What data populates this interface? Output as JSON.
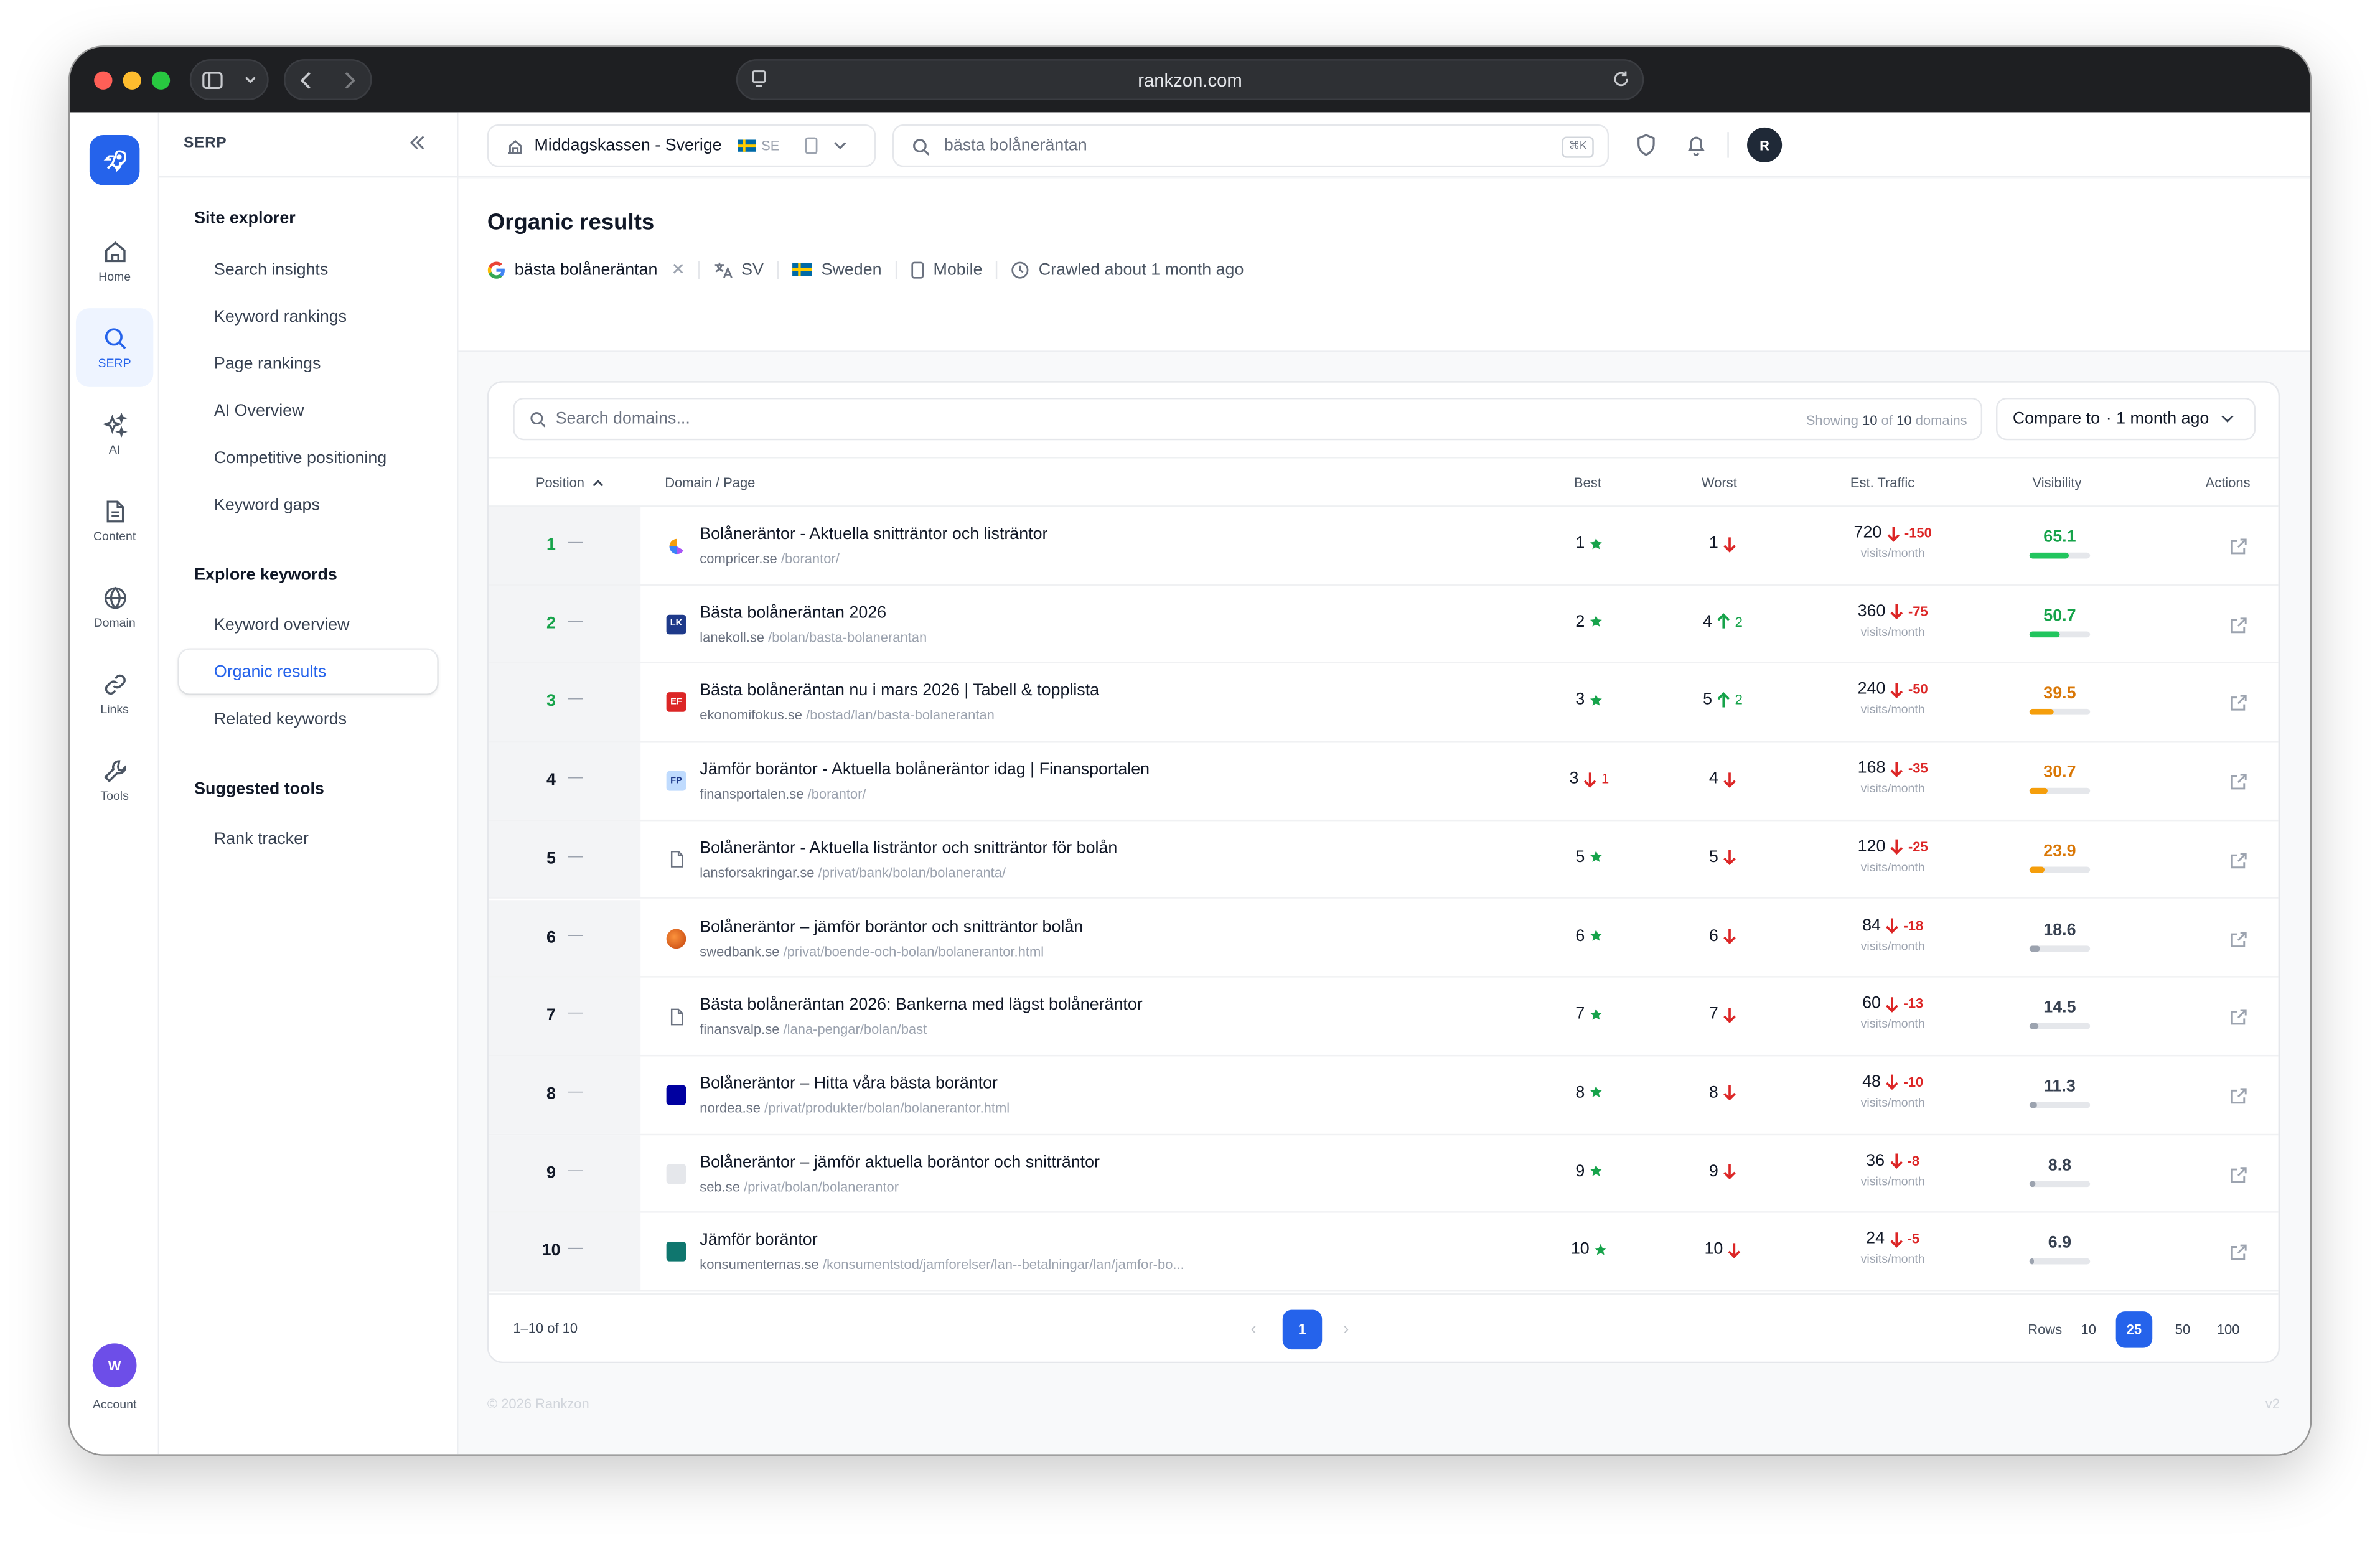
{
  "browser": {
    "url": "rankzon.com"
  },
  "rail": {
    "items": [
      {
        "label": "Home",
        "icon": "home-icon"
      },
      {
        "label": "SERP",
        "icon": "search-icon"
      },
      {
        "label": "AI",
        "icon": "sparkles-icon"
      },
      {
        "label": "Content",
        "icon": "document-icon"
      },
      {
        "label": "Domain",
        "icon": "globe-icon"
      },
      {
        "label": "Links",
        "icon": "link-icon"
      },
      {
        "label": "Tools",
        "icon": "wrench-icon"
      }
    ],
    "account_initial": "W",
    "account_label": "Account"
  },
  "sidenav": {
    "title": "SERP",
    "groups": [
      {
        "label": "Site explorer",
        "items": [
          "Search insights",
          "Keyword rankings",
          "Page rankings",
          "AI Overview",
          "Competitive positioning",
          "Keyword gaps"
        ]
      },
      {
        "label": "Explore keywords",
        "items": [
          "Keyword overview",
          "Organic results",
          "Related keywords"
        ]
      },
      {
        "label": "Suggested tools",
        "items": [
          "Rank tracker"
        ]
      }
    ],
    "active_item": "Organic results"
  },
  "topbar": {
    "project": "Middagskassen - Sverige",
    "project_country": "SE",
    "search_placeholder": "bästa bolåneräntan",
    "shortcut": "⌘K",
    "user_initial": "R"
  },
  "page": {
    "title": "Organic results",
    "keyword": "bästa bolåneräntan",
    "language": "SV",
    "country": "Sweden",
    "device": "Mobile",
    "crawled": "Crawled about 1 month ago"
  },
  "table": {
    "search_placeholder": "Search domains...",
    "showing_prefix": "Showing",
    "showing_count": "10",
    "showing_of": "of",
    "showing_total": "10",
    "showing_suffix": "domains",
    "compare_label": "Compare to",
    "compare_value": "· 1 month ago",
    "columns": {
      "position": "Position",
      "domain": "Domain / Page",
      "best": "Best",
      "worst": "Worst",
      "traffic": "Est. Traffic",
      "visibility": "Visibility",
      "actions": "Actions"
    },
    "traffic_unit": "visits/month",
    "rows": [
      {
        "pos": "1",
        "title": "Bolåneräntor - Aktuella snitträntor och listräntor",
        "domain": "compricer.se",
        "path": "/borantor/",
        "best": "1",
        "best_dir": "star",
        "best_delta": "",
        "worst": "1",
        "worst_dir": "down",
        "worst_delta": "",
        "traffic": "720",
        "traffic_change": "-150",
        "visibility": "65.1",
        "vis_pct": 65.1,
        "vis_color": "#22c55e",
        "favicon_color": "#f59e0b",
        "favicon_text": ""
      },
      {
        "pos": "2",
        "title": "Bästa bolåneräntan 2026",
        "domain": "lanekoll.se",
        "path": "/bolan/basta-bolanerantan",
        "best": "2",
        "best_dir": "star",
        "best_delta": "",
        "worst": "4",
        "worst_dir": "up",
        "worst_delta": "2",
        "traffic": "360",
        "traffic_change": "-75",
        "visibility": "50.7",
        "vis_pct": 50.7,
        "vis_color": "#22c55e",
        "favicon_color": "#1e3a8a",
        "favicon_text": "LK"
      },
      {
        "pos": "3",
        "title": "Bästa bolåneräntan nu i mars 2026 | Tabell & topplista",
        "domain": "ekonomifokus.se",
        "path": "/bostad/lan/basta-bolanerantan",
        "best": "3",
        "best_dir": "star",
        "best_delta": "",
        "worst": "5",
        "worst_dir": "up",
        "worst_delta": "2",
        "traffic": "240",
        "traffic_change": "-50",
        "visibility": "39.5",
        "vis_pct": 39.5,
        "vis_color": "#f59e0b",
        "favicon_color": "#dc2626",
        "favicon_text": "EF"
      },
      {
        "pos": "4",
        "title": "Jämför boräntor - Aktuella bolåneräntor idag | Finansportalen",
        "domain": "finansportalen.se",
        "path": "/borantor/",
        "best": "3",
        "best_dir": "down",
        "best_delta": "1",
        "worst": "4",
        "worst_dir": "down",
        "worst_delta": "",
        "traffic": "168",
        "traffic_change": "-35",
        "visibility": "30.7",
        "vis_pct": 30.7,
        "vis_color": "#f59e0b",
        "favicon_color": "#bfdbfe",
        "favicon_text": "FP"
      },
      {
        "pos": "5",
        "title": "Bolåneräntor - Aktuella listräntor och snitträntor för bolån",
        "domain": "lansforsakringar.se",
        "path": "/privat/bank/bolan/bolaneranta/",
        "best": "5",
        "best_dir": "star",
        "best_delta": "",
        "worst": "5",
        "worst_dir": "down",
        "worst_delta": "",
        "traffic": "120",
        "traffic_change": "-25",
        "visibility": "23.9",
        "vis_pct": 23.9,
        "vis_color": "#f59e0b",
        "favicon_color": "",
        "favicon_text": ""
      },
      {
        "pos": "6",
        "title": "Bolåneräntor – jämför boräntor och snitträntor bolån",
        "domain": "swedbank.se",
        "path": "/privat/boende-och-bolan/bolanerantor.html",
        "best": "6",
        "best_dir": "star",
        "best_delta": "",
        "worst": "6",
        "worst_dir": "down",
        "worst_delta": "",
        "traffic": "84",
        "traffic_change": "-18",
        "visibility": "18.6",
        "vis_pct": 18.6,
        "vis_color": "#9ca3af",
        "favicon_color": "#ea580c",
        "favicon_text": ""
      },
      {
        "pos": "7",
        "title": "Bästa bolåneräntan 2026: Bankerna med lägst bolåneräntor",
        "domain": "finansvalp.se",
        "path": "/lana-pengar/bolan/bast",
        "best": "7",
        "best_dir": "star",
        "best_delta": "",
        "worst": "7",
        "worst_dir": "down",
        "worst_delta": "",
        "traffic": "60",
        "traffic_change": "-13",
        "visibility": "14.5",
        "vis_pct": 14.5,
        "vis_color": "#9ca3af",
        "favicon_color": "",
        "favicon_text": ""
      },
      {
        "pos": "8",
        "title": "Bolåneräntor – Hitta våra bästa boräntor",
        "domain": "nordea.se",
        "path": "/privat/produkter/bolan/bolanerantor.html",
        "best": "8",
        "best_dir": "star",
        "best_delta": "",
        "worst": "8",
        "worst_dir": "down",
        "worst_delta": "",
        "traffic": "48",
        "traffic_change": "-10",
        "visibility": "11.3",
        "vis_pct": 11.3,
        "vis_color": "#9ca3af",
        "favicon_color": "#0000a0",
        "favicon_text": ""
      },
      {
        "pos": "9",
        "title": "Bolåneräntor – jämför aktuella boräntor och snitträntor",
        "domain": "seb.se",
        "path": "/privat/bolan/bolanerantor",
        "best": "9",
        "best_dir": "star",
        "best_delta": "",
        "worst": "9",
        "worst_dir": "down",
        "worst_delta": "",
        "traffic": "36",
        "traffic_change": "-8",
        "visibility": "8.8",
        "vis_pct": 8.8,
        "vis_color": "#9ca3af",
        "favicon_color": "#e5e7eb",
        "favicon_text": ""
      },
      {
        "pos": "10",
        "title": "Jämför boräntor",
        "domain": "konsumenternas.se",
        "path": "/konsumentstod/jamforelser/lan--betalningar/lan/jamfor-bo...",
        "best": "10",
        "best_dir": "star",
        "best_delta": "",
        "worst": "10",
        "worst_dir": "down",
        "worst_delta": "",
        "traffic": "24",
        "traffic_change": "-5",
        "visibility": "6.9",
        "vis_pct": 6.9,
        "vis_color": "#9ca3af",
        "favicon_color": "#0f766e",
        "favicon_text": ""
      }
    ],
    "footer": {
      "range": "1–10 of 10",
      "current_page": "1",
      "rows_label": "Rows",
      "rows_options": [
        "10",
        "25",
        "50",
        "100"
      ],
      "rows_active": "25"
    }
  },
  "footer": {
    "copyright": "© 2026 Rankzon",
    "version": "v2"
  },
  "colors": {
    "accent": "#2563eb",
    "success": "#16a34a",
    "danger": "#dc2626",
    "warning": "#f59e0b"
  }
}
